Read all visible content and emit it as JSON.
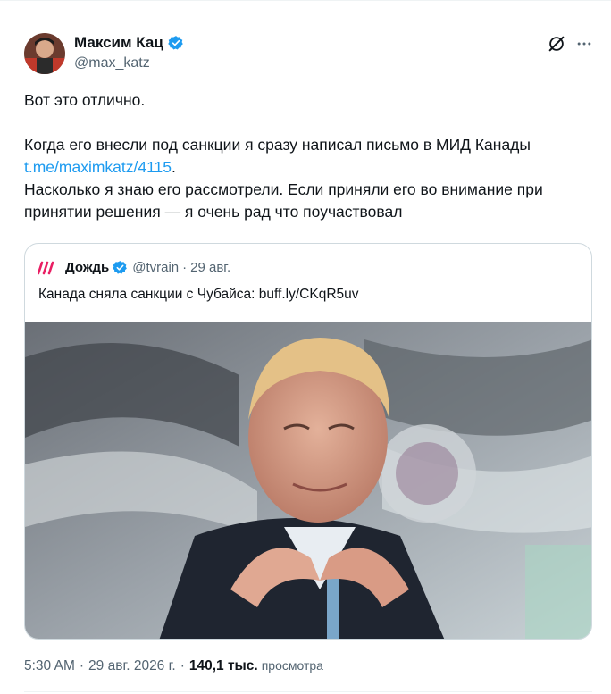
{
  "author": {
    "name": "Максим Кац",
    "handle": "@max_katz",
    "avatar_icon": "author-avatar",
    "verified_color": "#1d9bf0"
  },
  "tweet": {
    "line1": "Вот это отлично.",
    "para2_text": "Когда его внесли под санкции я сразу написал письмо в МИД Канады",
    "para2_link": "t.me/maximkatz/4115",
    "para2_end": ".",
    "para3": "Насколько я знаю его рассмотрели. Если приняли его во внимание при принятии решения — я очень рад что поучаствовал"
  },
  "quote": {
    "name": "Дождь",
    "handle": "@tvrain",
    "dot": "·",
    "date": "29 авг.",
    "text": "Канада сняла санкции с Чубайса: buff.ly/CKqR5uv",
    "logo_color": "#e91e63"
  },
  "meta": {
    "time": "5:30 AM",
    "sep": "·",
    "date": "29 авг. 2026 г.",
    "sep2": "·",
    "views": "140,1 тыс.",
    "views_label": "просмотра"
  },
  "colors": {
    "accent": "#1d9bf0",
    "muted": "#536471",
    "border": "#cfd9de"
  }
}
